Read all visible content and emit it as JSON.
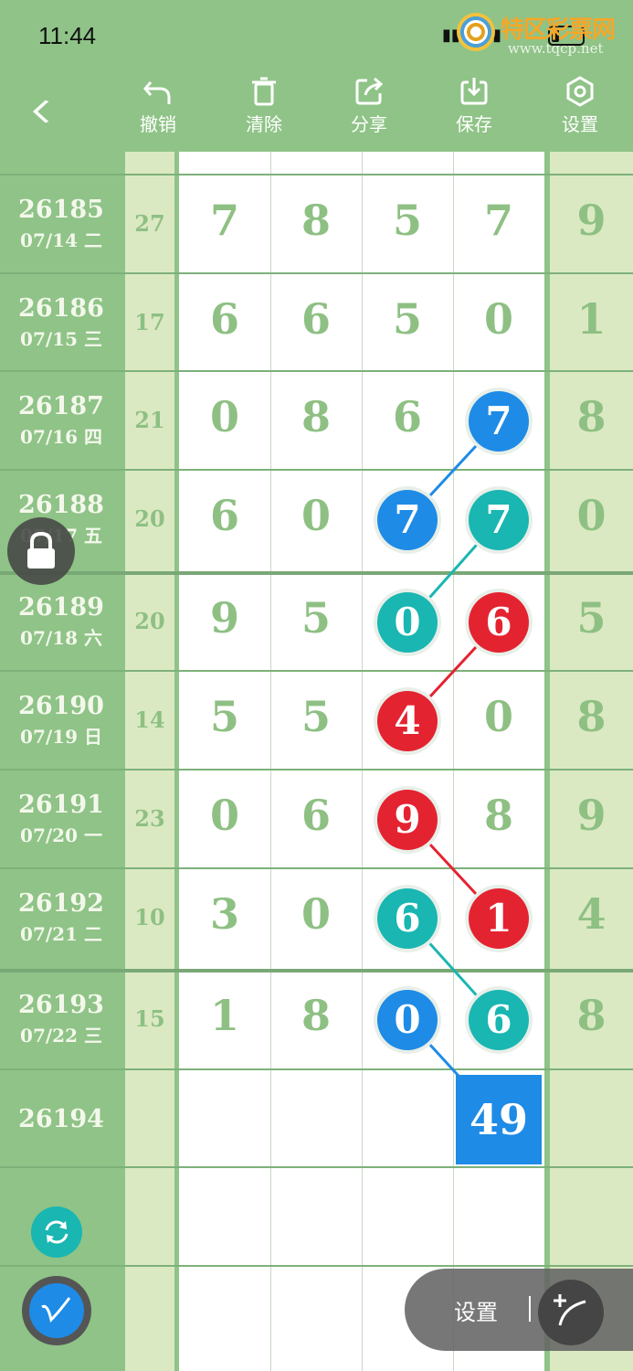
{
  "status": {
    "time": "11:44",
    "watermark_title": "特区彩票网",
    "watermark_url": "www.tqcp.net"
  },
  "toolbar": {
    "undo": "撤销",
    "clear": "清除",
    "share": "分享",
    "save": "保存",
    "settings": "设置"
  },
  "rows": [
    {
      "issue": "26185",
      "date": "07/14 二",
      "sum": "27",
      "digits": [
        "7",
        "8",
        "5",
        "7"
      ],
      "right": "9"
    },
    {
      "issue": "26186",
      "date": "07/15 三",
      "sum": "17",
      "digits": [
        "6",
        "6",
        "5",
        "0"
      ],
      "right": "1"
    },
    {
      "issue": "26187",
      "date": "07/16 四",
      "sum": "21",
      "digits": [
        "0",
        "8",
        "6",
        "7"
      ],
      "right": "8"
    },
    {
      "issue": "26188",
      "date": "07/17 五",
      "sum": "20",
      "digits": [
        "6",
        "0",
        "7",
        "7"
      ],
      "right": "0"
    },
    {
      "issue": "26189",
      "date": "07/18 六",
      "sum": "20",
      "digits": [
        "9",
        "5",
        "0",
        "6"
      ],
      "right": "5"
    },
    {
      "issue": "26190",
      "date": "07/19 日",
      "sum": "14",
      "digits": [
        "5",
        "5",
        "4",
        "0"
      ],
      "right": "8"
    },
    {
      "issue": "26191",
      "date": "07/20 一",
      "sum": "23",
      "digits": [
        "0",
        "6",
        "9",
        "8"
      ],
      "right": "9"
    },
    {
      "issue": "26192",
      "date": "07/21 二",
      "sum": "10",
      "digits": [
        "3",
        "0",
        "6",
        "1"
      ],
      "right": "4"
    },
    {
      "issue": "26193",
      "date": "07/22 三",
      "sum": "15",
      "digits": [
        "1",
        "8",
        "0",
        "6"
      ],
      "right": "8"
    },
    {
      "issue": "26194",
      "date": "",
      "sum": "",
      "digits": [
        "",
        "",
        "",
        ""
      ],
      "right": ""
    }
  ],
  "prediction": "49",
  "highlights": [
    {
      "row": 2,
      "col": 3,
      "color": "blue"
    },
    {
      "row": 3,
      "col": 2,
      "color": "blue"
    },
    {
      "row": 3,
      "col": 3,
      "color": "teal"
    },
    {
      "row": 4,
      "col": 2,
      "color": "teal"
    },
    {
      "row": 4,
      "col": 3,
      "color": "red"
    },
    {
      "row": 5,
      "col": 2,
      "color": "red"
    },
    {
      "row": 6,
      "col": 2,
      "color": "red"
    },
    {
      "row": 7,
      "col": 2,
      "color": "teal"
    },
    {
      "row": 7,
      "col": 3,
      "color": "red"
    },
    {
      "row": 8,
      "col": 2,
      "color": "blue"
    },
    {
      "row": 8,
      "col": 3,
      "color": "teal"
    }
  ],
  "colors": {
    "blue": "#1e8be6",
    "teal": "#19b6b2",
    "red": "#e42331"
  },
  "links": [
    {
      "from": [
        2,
        3
      ],
      "to": [
        3,
        2
      ],
      "color": "blue"
    },
    {
      "from": [
        3,
        3
      ],
      "to": [
        4,
        2
      ],
      "color": "teal"
    },
    {
      "from": [
        4,
        3
      ],
      "to": [
        5,
        2
      ],
      "color": "red"
    },
    {
      "from": [
        6,
        2
      ],
      "to": [
        7,
        3
      ],
      "color": "red"
    },
    {
      "from": [
        7,
        2
      ],
      "to": [
        8,
        3
      ],
      "color": "teal"
    },
    {
      "from": [
        8,
        2
      ],
      "to": [
        9,
        3
      ],
      "color": "blue"
    }
  ],
  "floating": {
    "settings_label": "设置",
    "icons": [
      "lock-icon",
      "refresh-icon",
      "pen-icon",
      "curve-tool-icon"
    ]
  }
}
